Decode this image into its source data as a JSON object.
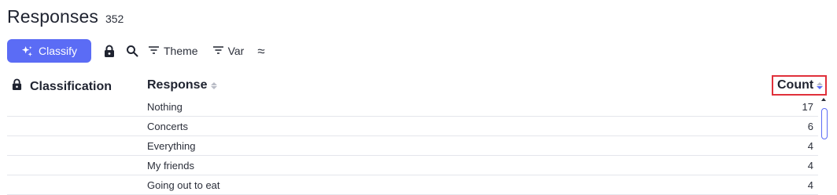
{
  "header": {
    "title": "Responses",
    "count": "352"
  },
  "toolbar": {
    "classify_label": "Classify",
    "theme_label": "Theme",
    "var_label": "Var",
    "approx_symbol": "≈"
  },
  "table": {
    "columns": {
      "classification": "Classification",
      "response": "Response",
      "count": "Count"
    },
    "rows": [
      {
        "response": "Nothing",
        "count": "17"
      },
      {
        "response": "Concerts",
        "count": "6"
      },
      {
        "response": "Everything",
        "count": "4"
      },
      {
        "response": "My friends",
        "count": "4"
      },
      {
        "response": "Going out to eat",
        "count": "4"
      }
    ]
  },
  "colors": {
    "accent": "#5b6cf5",
    "highlight_border": "#e0303a"
  }
}
